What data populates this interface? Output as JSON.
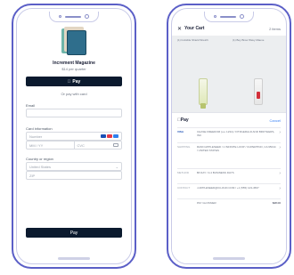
{
  "left_phone": {
    "product": {
      "title": "Increment Magazine",
      "price": "$14 per quarter"
    },
    "apple_pay_button": {
      "label": "Pay"
    },
    "or_pay_with_card": "Or pay with card",
    "email": {
      "label": "Email"
    },
    "card_information": {
      "label": "Card information",
      "number_placeholder": "Number",
      "expiry_placeholder": "MM / YY",
      "cvc_placeholder": "CVC"
    },
    "country_or_region": {
      "label": "Country or region",
      "country_value": "United States",
      "zip_placeholder": "ZIP"
    },
    "pay_button": {
      "label": "Pay"
    }
  },
  "right_phone": {
    "brand": "Glossier",
    "cart_title": "Your Cart",
    "cart_count": "2 items",
    "item_1_name": "(1) Invisible Shield Stretch",
    "item_2_name": "(1) Boy Brow Wavy Mauve",
    "apple_pay_sheet": {
      "title": "Pay",
      "cancel": "Cancel",
      "card": {
        "badge": "VISA",
        "value": "CHASE FREEDOM (•••• 1234) / FITZGERALD AND BROTHERS, INC"
      },
      "shipping": {
        "label": "SHIPPING",
        "value": "RANN APPLESEED / 1 INFINITE LOOP / CUPERTINO, CA 95014 / UNITED STATES"
      },
      "method": {
        "label": "METHOD",
        "value": "$5 DAY / 3-4 BUSINESS DAYS"
      },
      "contact": {
        "label": "CONTACT",
        "value": "J.APPLESEED@ICLOUD.COM / +1 (555) 123-4567"
      },
      "total": {
        "label": "PAY GLOSSIER",
        "value": "$48.00"
      }
    }
  },
  "colors": {
    "frame": "#5b5fc7",
    "button_dark": "#0b1a2e",
    "link_blue": "#3b82f6"
  }
}
